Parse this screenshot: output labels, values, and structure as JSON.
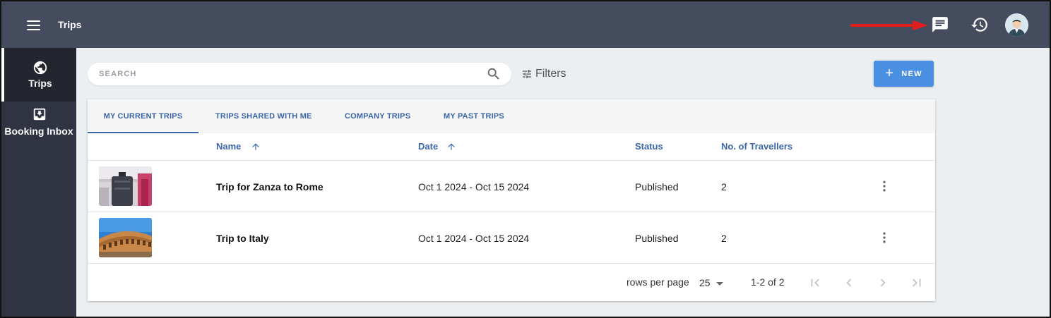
{
  "header": {
    "title": "Trips",
    "menu_icon": "menu-icon",
    "chat_icon": "chat-icon",
    "history_icon": "history-icon",
    "avatar_icon": "avatar-icon",
    "annotation_color": "#e01e1e"
  },
  "sidebar": {
    "items": [
      {
        "label": "Trips",
        "icon": "globe-icon",
        "active": true
      },
      {
        "label": "Booking Inbox",
        "icon": "inbox-icon",
        "active": false
      }
    ]
  },
  "toolbar": {
    "search_placeholder": "SEARCH",
    "search_value": "",
    "filters_label": "Filters",
    "new_label": "NEW"
  },
  "tabs": [
    {
      "label": "MY CURRENT TRIPS",
      "active": true
    },
    {
      "label": "TRIPS SHARED WITH ME",
      "active": false
    },
    {
      "label": "COMPANY TRIPS",
      "active": false
    },
    {
      "label": "MY PAST TRIPS",
      "active": false
    }
  ],
  "table": {
    "columns": [
      {
        "label": "Name",
        "sortable": true
      },
      {
        "label": "Date",
        "sortable": true
      },
      {
        "label": "Status",
        "sortable": false
      },
      {
        "label": "No. of Travellers",
        "sortable": false
      }
    ],
    "rows": [
      {
        "name": "Trip for Zanza to Rome",
        "date": "Oct 1 2024 - Oct 15 2024",
        "status": "Published",
        "travellers": "2",
        "thumbnail": "luggage-photo"
      },
      {
        "name": "Trip to Italy",
        "date": "Oct 1 2024 - Oct 15 2024",
        "status": "Published",
        "travellers": "2",
        "thumbnail": "colosseum-photo"
      }
    ]
  },
  "pagination": {
    "rows_per_page_label": "rows per page",
    "rows_per_page_value": "25",
    "range_label": "1-2 of 2"
  },
  "colors": {
    "topbar": "#454c5e",
    "sidebar": "#2f3342",
    "accent": "#3b66a8",
    "new_button": "#4a90e2"
  }
}
